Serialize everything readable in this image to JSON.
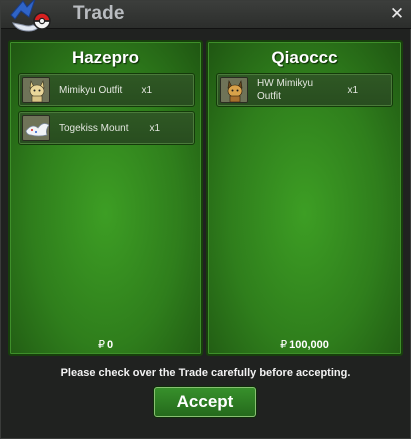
{
  "window": {
    "title": "Trade",
    "close_icon": "close-icon"
  },
  "players": [
    {
      "name": "Hazepro",
      "money_symbol": "₽",
      "money": "0",
      "items": [
        {
          "name": "Mimikyu Outfit",
          "qty": "x1",
          "icon": "mimikyu-outfit-icon"
        },
        {
          "name": "Togekiss Mount",
          "qty": "x1",
          "icon": "togekiss-mount-icon"
        }
      ]
    },
    {
      "name": "Qiaoccc",
      "money_symbol": "₽",
      "money": "100,000",
      "items": [
        {
          "name": "HW Mimikyu Outfit",
          "qty": "x1",
          "icon": "hw-mimikyu-outfit-icon"
        }
      ]
    }
  ],
  "notice": "Please check over the Trade carefully before accepting.",
  "accept_label": "Accept",
  "colors": {
    "panel": "#2f7e1c",
    "slot": "#2f5824",
    "button": "#2f7f24"
  }
}
